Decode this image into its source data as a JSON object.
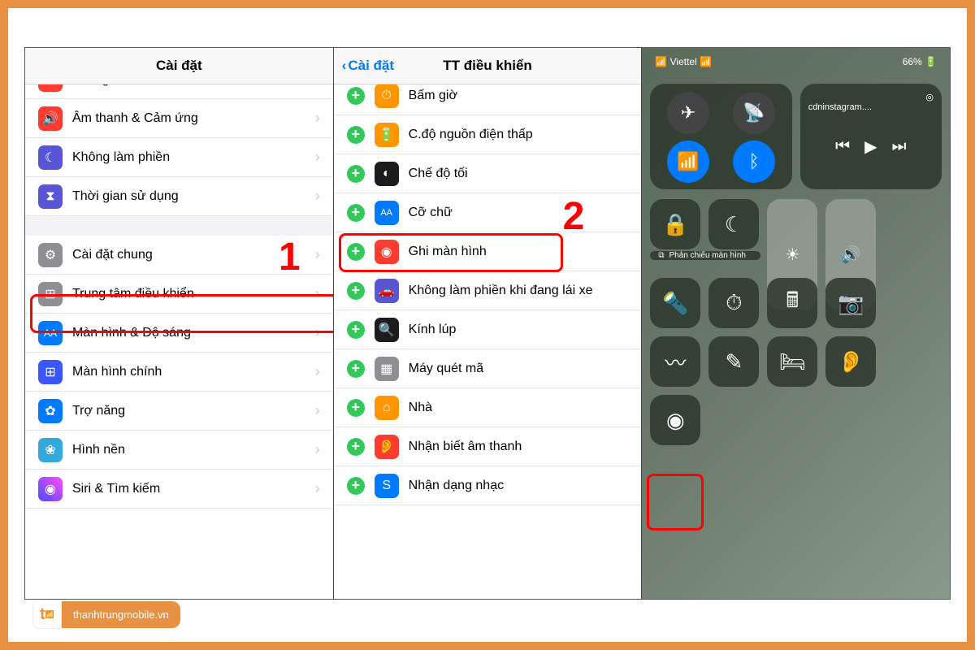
{
  "panel1": {
    "title": "Cài đặt",
    "items": [
      {
        "label": "Thông báo",
        "color": "#ff3b30",
        "hasChev": true,
        "clipped": true
      },
      {
        "label": "Âm thanh & Cảm ứng",
        "color": "#ff3b30",
        "hasChev": true
      },
      {
        "label": "Không làm phiền",
        "color": "#5856d6",
        "hasChev": true
      },
      {
        "label": "Thời gian sử dụng",
        "color": "#5856d6",
        "hasChev": true
      },
      {
        "spacer": true
      },
      {
        "label": "Cài đặt chung",
        "color": "#8e8e93",
        "hasChev": true
      },
      {
        "label": "Trung tâm điều khiển",
        "color": "#8e8e93",
        "hasChev": true,
        "highlight": true
      },
      {
        "label": "Màn hình & Độ sáng",
        "color": "#007aff",
        "hasChev": true
      },
      {
        "label": "Màn hình chính",
        "color": "#3a57ff",
        "hasChev": true
      },
      {
        "label": "Trợ năng",
        "color": "#007aff",
        "hasChev": true
      },
      {
        "label": "Hình nền",
        "color": "#34aadc",
        "hasChev": true
      },
      {
        "label": "Siri & Tìm kiếm",
        "color": "#1a1a2e",
        "hasChev": true
      }
    ],
    "step": "1"
  },
  "panel2": {
    "back": "Cài đặt",
    "title": "TT điều khiển",
    "items": [
      {
        "label": "Bấm giờ",
        "color": "#ff9500"
      },
      {
        "label": "C.độ nguồn điện thấp",
        "color": "#ff9500"
      },
      {
        "label": "Chế độ tối",
        "color": "#1c1c1e"
      },
      {
        "label": "Cỡ chữ",
        "color": "#007aff"
      },
      {
        "label": "Ghi màn hình",
        "color": "#ff3b30",
        "highlight": true
      },
      {
        "label": "Không làm phiền khi đang lái xe",
        "color": "#5856d6"
      },
      {
        "label": "Kính lúp",
        "color": "#1c1c1e"
      },
      {
        "label": "Máy quét mã",
        "color": "#8e8e93"
      },
      {
        "label": "Nhà",
        "color": "#ff9500"
      },
      {
        "label": "Nhận biết âm thanh",
        "color": "#ff3b30"
      },
      {
        "label": "Nhận dạng nhạc",
        "color": "#007aff"
      }
    ],
    "step": "2"
  },
  "cc": {
    "carrier": "Viettel",
    "battery": "66%",
    "media": "cdninstagram....",
    "mirror": "Phản chiếu màn hình"
  },
  "logo": "thanhtrungmobile.vn"
}
